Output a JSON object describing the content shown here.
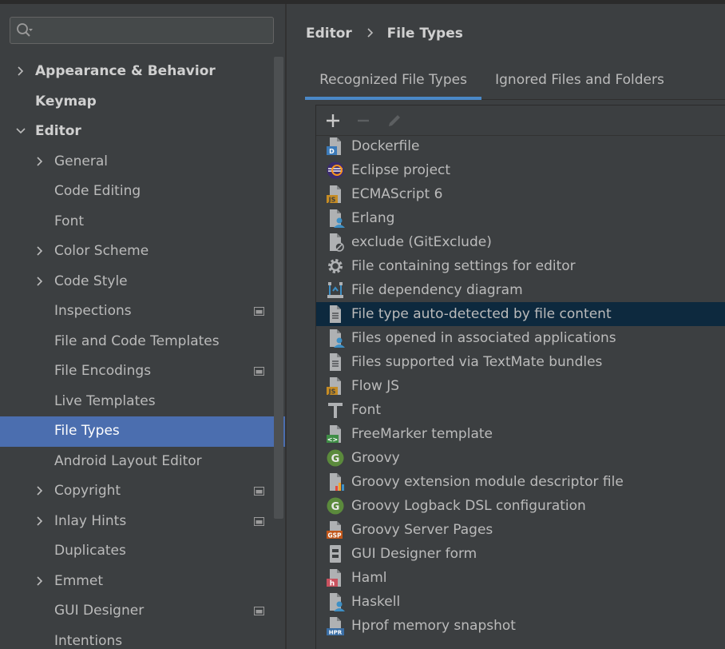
{
  "search": {
    "value": "",
    "placeholder": ""
  },
  "tree": [
    {
      "label": "Appearance & Behavior",
      "level": 0,
      "expander": "collapsed",
      "bold": true,
      "selected": false,
      "project": false
    },
    {
      "label": "Keymap",
      "level": 0,
      "expander": "none",
      "bold": true,
      "selected": false,
      "project": false
    },
    {
      "label": "Editor",
      "level": 0,
      "expander": "expanded",
      "bold": true,
      "selected": false,
      "project": false
    },
    {
      "label": "General",
      "level": 1,
      "expander": "collapsed",
      "bold": false,
      "selected": false,
      "project": false
    },
    {
      "label": "Code Editing",
      "level": 1,
      "expander": "none",
      "bold": false,
      "selected": false,
      "project": false
    },
    {
      "label": "Font",
      "level": 1,
      "expander": "none",
      "bold": false,
      "selected": false,
      "project": false
    },
    {
      "label": "Color Scheme",
      "level": 1,
      "expander": "collapsed",
      "bold": false,
      "selected": false,
      "project": false
    },
    {
      "label": "Code Style",
      "level": 1,
      "expander": "collapsed",
      "bold": false,
      "selected": false,
      "project": false
    },
    {
      "label": "Inspections",
      "level": 1,
      "expander": "none",
      "bold": false,
      "selected": false,
      "project": true
    },
    {
      "label": "File and Code Templates",
      "level": 1,
      "expander": "none",
      "bold": false,
      "selected": false,
      "project": false
    },
    {
      "label": "File Encodings",
      "level": 1,
      "expander": "none",
      "bold": false,
      "selected": false,
      "project": true
    },
    {
      "label": "Live Templates",
      "level": 1,
      "expander": "none",
      "bold": false,
      "selected": false,
      "project": false
    },
    {
      "label": "File Types",
      "level": 1,
      "expander": "none",
      "bold": false,
      "selected": true,
      "project": false
    },
    {
      "label": "Android Layout Editor",
      "level": 1,
      "expander": "none",
      "bold": false,
      "selected": false,
      "project": false
    },
    {
      "label": "Copyright",
      "level": 1,
      "expander": "collapsed",
      "bold": false,
      "selected": false,
      "project": true
    },
    {
      "label": "Inlay Hints",
      "level": 1,
      "expander": "collapsed",
      "bold": false,
      "selected": false,
      "project": true
    },
    {
      "label": "Duplicates",
      "level": 1,
      "expander": "none",
      "bold": false,
      "selected": false,
      "project": false
    },
    {
      "label": "Emmet",
      "level": 1,
      "expander": "collapsed",
      "bold": false,
      "selected": false,
      "project": false
    },
    {
      "label": "GUI Designer",
      "level": 1,
      "expander": "none",
      "bold": false,
      "selected": false,
      "project": true
    },
    {
      "label": "Intentions",
      "level": 1,
      "expander": "none",
      "bold": false,
      "selected": false,
      "project": false
    }
  ],
  "breadcrumb": {
    "parent": "Editor",
    "current": "File Types"
  },
  "tabs": [
    {
      "label": "Recognized File Types",
      "active": true
    },
    {
      "label": "Ignored Files and Folders",
      "active": false
    }
  ],
  "file_types": [
    {
      "name": "Dockerfile",
      "icon": "docker",
      "badge": "D",
      "selected": false
    },
    {
      "name": "Eclipse project",
      "icon": "eclipse",
      "badge": "",
      "selected": false
    },
    {
      "name": "ECMAScript 6",
      "icon": "js",
      "badge": "JS",
      "selected": false
    },
    {
      "name": "Erlang",
      "icon": "file-user",
      "badge": "",
      "selected": false
    },
    {
      "name": "exclude (GitExclude)",
      "icon": "file-exclude",
      "badge": "",
      "selected": false
    },
    {
      "name": "File containing settings for editor",
      "icon": "gear",
      "badge": "",
      "selected": false
    },
    {
      "name": "File dependency diagram",
      "icon": "diagram",
      "badge": "",
      "selected": false
    },
    {
      "name": "File type auto-detected by file content",
      "icon": "file-text",
      "badge": "",
      "selected": true
    },
    {
      "name": "Files opened in associated applications",
      "icon": "file-user",
      "badge": "",
      "selected": false
    },
    {
      "name": "Files supported via TextMate bundles",
      "icon": "file-text",
      "badge": "",
      "selected": false
    },
    {
      "name": "Flow JS",
      "icon": "js",
      "badge": "JS",
      "selected": false
    },
    {
      "name": "Font",
      "icon": "font",
      "badge": "",
      "selected": false
    },
    {
      "name": "FreeMarker template",
      "icon": "freemarker",
      "badge": "<>",
      "selected": false
    },
    {
      "name": "Groovy",
      "icon": "groovy",
      "badge": "G",
      "selected": false
    },
    {
      "name": "Groovy extension module descriptor file",
      "icon": "file-chart",
      "badge": "",
      "selected": false
    },
    {
      "name": "Groovy Logback DSL configuration",
      "icon": "groovy",
      "badge": "G",
      "selected": false
    },
    {
      "name": "Groovy Server Pages",
      "icon": "gsp",
      "badge": "GSP",
      "selected": false
    },
    {
      "name": "GUI Designer form",
      "icon": "form",
      "badge": "",
      "selected": false
    },
    {
      "name": "Haml",
      "icon": "haml",
      "badge": "h",
      "selected": false
    },
    {
      "name": "Haskell",
      "icon": "file-user",
      "badge": "",
      "selected": false
    },
    {
      "name": "Hprof memory snapshot",
      "icon": "hprof",
      "badge": "HPR",
      "selected": false
    }
  ],
  "colors": {
    "background": "#3c3f41",
    "selection": "#4b6eaf",
    "list_selection": "#0d293e",
    "tab_underline": "#4a88c7",
    "text": "#bbbbbb"
  }
}
